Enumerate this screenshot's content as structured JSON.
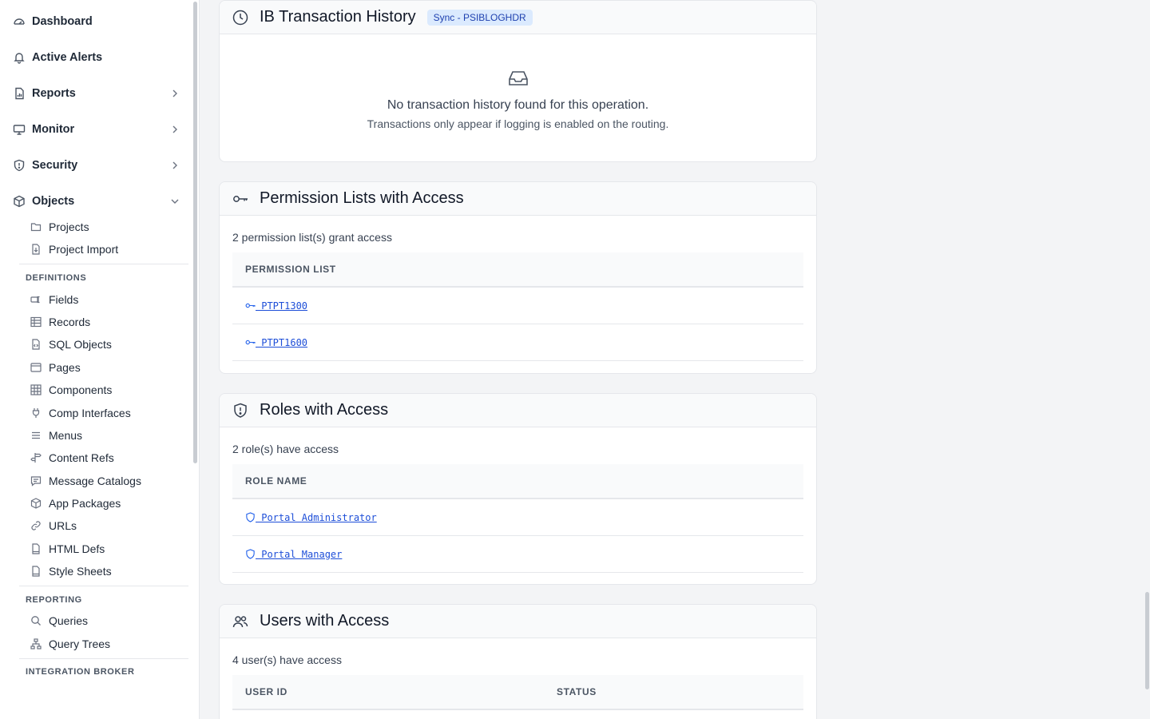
{
  "sidebar": {
    "top_items": [
      {
        "label": "Dashboard",
        "icon": "gauge-icon"
      },
      {
        "label": "Active Alerts",
        "icon": "bell-icon"
      },
      {
        "label": "Reports",
        "icon": "report-icon"
      },
      {
        "label": "Monitor",
        "icon": "monitor-icon"
      },
      {
        "label": "Security",
        "icon": "shield-icon"
      },
      {
        "label": "Objects",
        "icon": "cube-icon"
      }
    ],
    "objects_items": [
      {
        "label": "Projects",
        "icon": "folder-icon"
      },
      {
        "label": "Project Import",
        "icon": "file-import-icon"
      }
    ],
    "definitions_heading": "DEFINITIONS",
    "definitions_items": [
      {
        "label": "Fields",
        "icon": "field-icon"
      },
      {
        "label": "Records",
        "icon": "table-icon"
      },
      {
        "label": "SQL Objects",
        "icon": "file-code-icon"
      },
      {
        "label": "Pages",
        "icon": "browser-icon"
      },
      {
        "label": "Components",
        "icon": "grid-icon"
      },
      {
        "label": "Comp Interfaces",
        "icon": "plug-icon"
      },
      {
        "label": "Menus",
        "icon": "menu-icon"
      },
      {
        "label": "Content Refs",
        "icon": "signpost-icon"
      },
      {
        "label": "Message Catalogs",
        "icon": "message-icon"
      },
      {
        "label": "App Packages",
        "icon": "package-icon"
      },
      {
        "label": "URLs",
        "icon": "link-icon"
      },
      {
        "label": "HTML Defs",
        "icon": "file-html-icon"
      },
      {
        "label": "Style Sheets",
        "icon": "file-style-icon"
      }
    ],
    "reporting_heading": "REPORTING",
    "reporting_items": [
      {
        "label": "Queries",
        "icon": "search-icon"
      },
      {
        "label": "Query Trees",
        "icon": "tree-icon"
      }
    ],
    "integration_heading": "INTEGRATION BROKER"
  },
  "ib_history": {
    "title": "IB Transaction History",
    "badge": "Sync - PSIBLOGHDR",
    "empty_message": "No transaction history found for this operation.",
    "empty_hint": "Transactions only appear if logging is enabled on the routing."
  },
  "permission_lists": {
    "title": "Permission Lists with Access",
    "count_text": "2 permission list(s) grant access",
    "column": "PERMISSION LIST",
    "rows": [
      " PTPT1300",
      " PTPT1600"
    ]
  },
  "roles": {
    "title": "Roles with Access",
    "count_text": "2 role(s) have access",
    "column": "ROLE NAME",
    "rows": [
      " Portal Administrator",
      " Portal Manager"
    ]
  },
  "users": {
    "title": "Users with Access",
    "count_text": "4 user(s) have access",
    "columns": [
      "USER ID",
      "STATUS"
    ]
  }
}
